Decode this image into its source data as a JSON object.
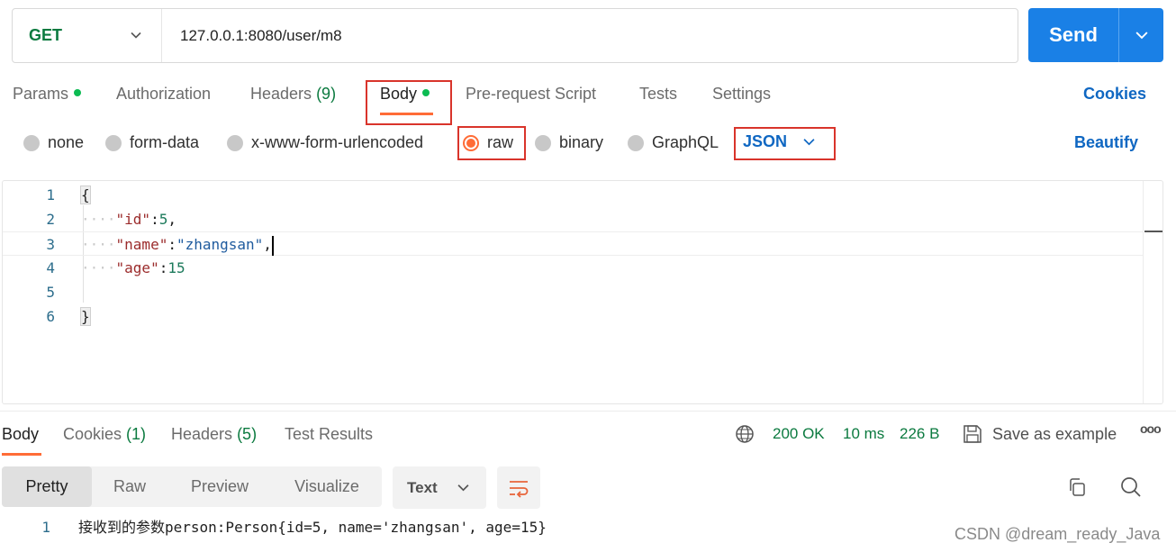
{
  "request": {
    "method": "GET",
    "url": "127.0.0.1:8080/user/m8",
    "send_label": "Send"
  },
  "request_tabs": [
    {
      "label": "Params",
      "dot": true
    },
    {
      "label": "Authorization"
    },
    {
      "label": "Headers",
      "count": "(9)"
    },
    {
      "label": "Body",
      "dot": true,
      "active": true
    },
    {
      "label": "Pre-request Script"
    },
    {
      "label": "Tests"
    },
    {
      "label": "Settings"
    }
  ],
  "cookies_label": "Cookies",
  "body_types": {
    "none": "none",
    "form_data": "form-data",
    "urlencoded": "x-www-form-urlencoded",
    "raw": "raw",
    "binary": "binary",
    "graphql": "GraphQL",
    "selected": "raw"
  },
  "raw_language": "JSON",
  "beautify_label": "Beautify",
  "editor": {
    "line_numbers": [
      "1",
      "2",
      "3",
      "4",
      "5",
      "6"
    ],
    "open_brace": "{",
    "indent": "····",
    "id_key": "\"id\"",
    "id_value": "5",
    "name_key": "\"name\"",
    "name_value": "\"zhangsan\"",
    "age_key": "\"age\"",
    "age_value": "15",
    "close_brace": "}",
    "colon": ":",
    "comma": ","
  },
  "response_tabs": [
    {
      "label": "Body",
      "active": true
    },
    {
      "label": "Cookies",
      "count": "(1)"
    },
    {
      "label": "Headers",
      "count": "(5)"
    },
    {
      "label": "Test Results"
    }
  ],
  "response_status": {
    "status": "200 OK",
    "time": "10 ms",
    "size": "226 B",
    "save_label": "Save as example",
    "more": "ooo"
  },
  "view_modes": [
    "Pretty",
    "Raw",
    "Preview",
    "Visualize"
  ],
  "response_format": "Text",
  "response_body": {
    "line_number": "1",
    "text": "接收到的参数person:Person{id=5, name='zhangsan', age=15}"
  },
  "watermark": "CSDN @dream_ready_Java",
  "colors": {
    "accent": "#ff6c37",
    "send": "#1a80e6",
    "link": "#0f67c2",
    "success": "#0b7a3f",
    "highlight_box": "#d9342b"
  }
}
